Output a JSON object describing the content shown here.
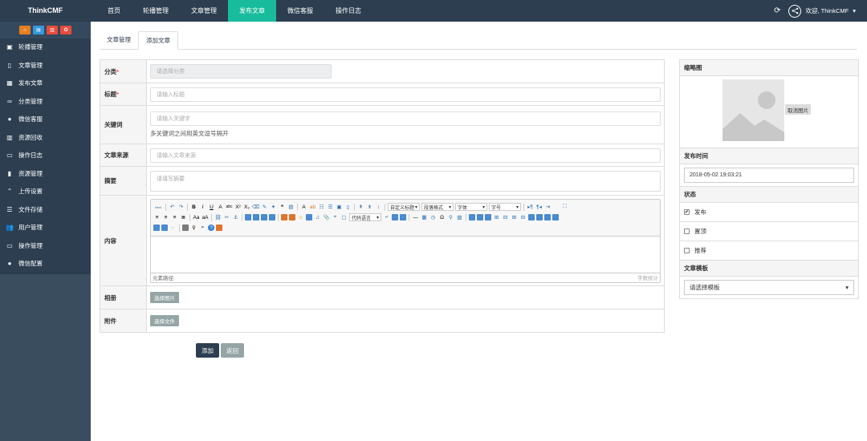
{
  "app": {
    "brand": "ThinkCMF"
  },
  "topnav": {
    "items": [
      "首页",
      "轮播管理",
      "文章管理",
      "发布文章",
      "微信客服",
      "操作日志"
    ],
    "active_index": 3,
    "user_greeting": "欢迎, ThinkCMF",
    "refresh_icon": "refresh-icon",
    "avatar_icon": "share-icon"
  },
  "sidebar": {
    "shortcut_colors": [
      "#e67e22",
      "#3498db",
      "#e74c3c",
      "#e74c3c"
    ],
    "items": [
      {
        "label": "轮播管理",
        "icon": "image-icon"
      },
      {
        "label": "文章管理",
        "icon": "file-icon"
      },
      {
        "label": "发布文章",
        "icon": "picture-icon"
      },
      {
        "label": "分类管理",
        "icon": "link-icon"
      },
      {
        "label": "微信客服",
        "icon": "chat-icon"
      },
      {
        "label": "资源回收",
        "icon": "trash-icon"
      },
      {
        "label": "操作日志",
        "icon": "monitor-icon"
      },
      {
        "label": "资源管理",
        "icon": "file-icon"
      },
      {
        "label": "上传设置",
        "icon": "chevron-up-icon"
      },
      {
        "label": "文件存储",
        "icon": "sliders-icon"
      },
      {
        "label": "用户管理",
        "icon": "users-icon"
      },
      {
        "label": "操作管理",
        "icon": "monitor-icon"
      },
      {
        "label": "微信配置",
        "icon": "chat-icon"
      }
    ]
  },
  "tabs": [
    "文章管理",
    "添加文章"
  ],
  "form": {
    "category": {
      "label": "分类",
      "placeholder": "请选择分类"
    },
    "title": {
      "label": "标题",
      "placeholder": "请输入标题"
    },
    "keywords": {
      "label": "关键词",
      "placeholder": "请输入关键字",
      "help": "多关键词之间用英文逗号隔开"
    },
    "source": {
      "label": "文章来源",
      "placeholder": "请输入文章来源"
    },
    "summary": {
      "label": "摘要",
      "placeholder": "请填写摘要"
    },
    "content": {
      "label": "内容"
    },
    "album": {
      "label": "相册",
      "button": "选择图片"
    },
    "attachment": {
      "label": "附件",
      "button": "选择文件"
    }
  },
  "editor": {
    "select_custom_title": "自定义标题",
    "select_paragraph": "段落格式",
    "select_font": "字体",
    "select_size": "字号",
    "select_code_lang": "代码语言",
    "element_path": "元素路径:",
    "word_count": "字数统计"
  },
  "actions": {
    "add": "添加",
    "back": "返回"
  },
  "right": {
    "thumbnail": {
      "label": "缩略图",
      "cancel": "取消图片"
    },
    "publish_time": {
      "label": "发布时间",
      "value": "2018-05-02 19:03:21"
    },
    "status": {
      "label": "状态",
      "options": [
        {
          "label": "发布",
          "checked": true
        },
        {
          "label": "置顶",
          "checked": false
        },
        {
          "label": "推荐",
          "checked": false
        }
      ]
    },
    "template": {
      "label": "文章模板",
      "placeholder": "请选择模板"
    }
  }
}
